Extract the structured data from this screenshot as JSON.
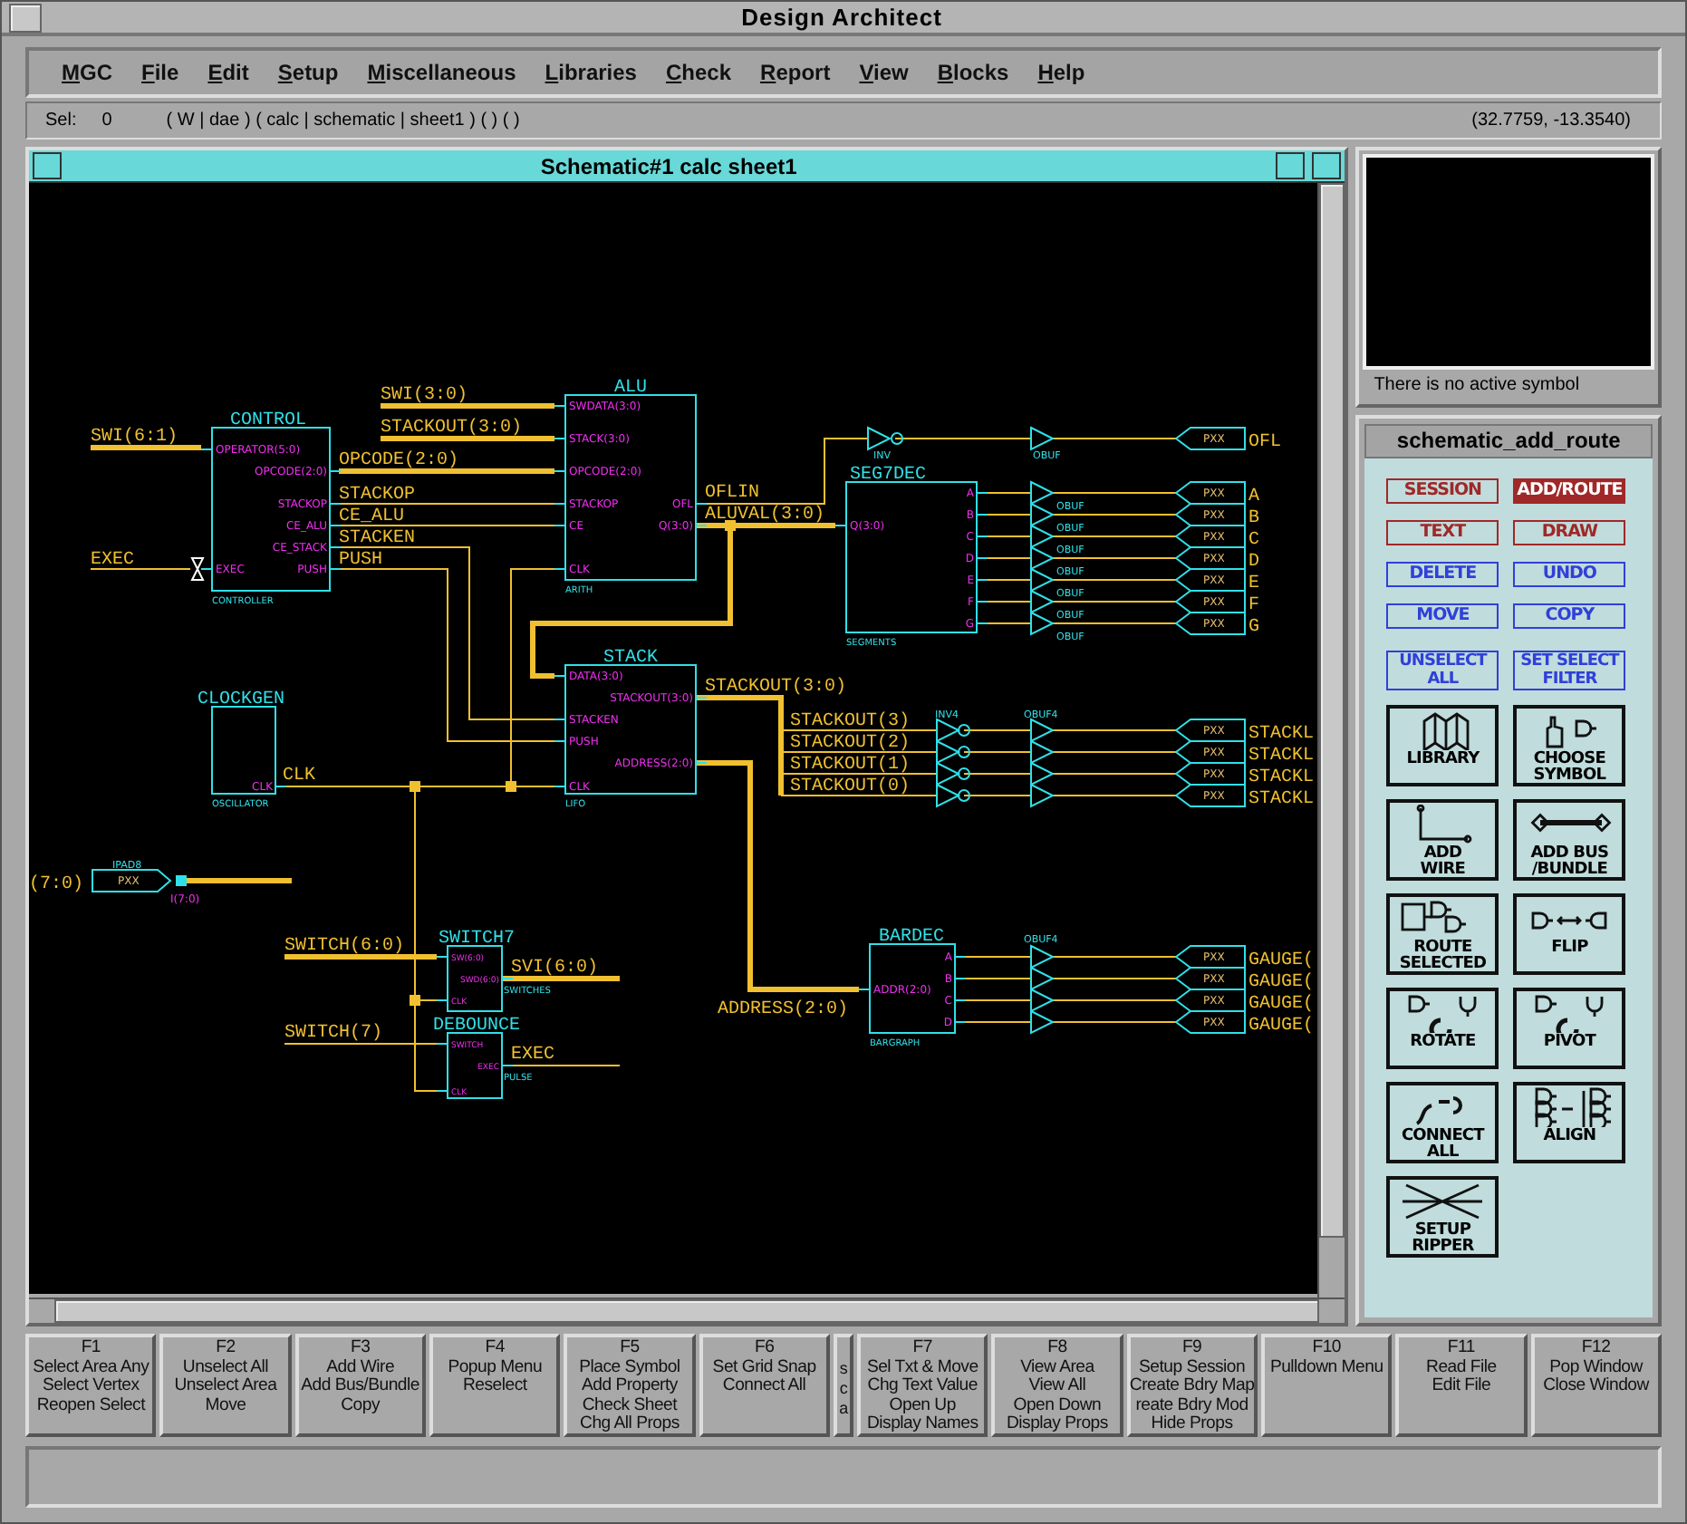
{
  "window": {
    "title": "Design Architect"
  },
  "menu": [
    "MGC",
    "File",
    "Edit",
    "Setup",
    "Miscellaneous",
    "Libraries",
    "Check",
    "Report",
    "View",
    "Blocks",
    "Help"
  ],
  "status": {
    "sel_label": "Sel:",
    "sel_count": "0",
    "context": "( W | dae ) ( calc | schematic | sheet1 ) ( ) ( )",
    "coordinates": "(32.7759, -13.3540)"
  },
  "schematic_window": {
    "title": "Schematic#1 calc sheet1"
  },
  "schematic": {
    "symbols": [
      {
        "name": "CONTROL",
        "footer": "CONTROLLER",
        "pins_left": [
          "OPERATOR(5:0)",
          "EXEC"
        ],
        "pins_right": [
          "OPCODE(2:0)",
          "STACKOP",
          "CE_ALU",
          "CE_STACK",
          "PUSH"
        ]
      },
      {
        "name": "CLOCKGEN",
        "footer": "OSCILLATOR",
        "pins_right": [
          "CLK"
        ]
      },
      {
        "name": "SWITCH7",
        "footer": "SWITCHES",
        "pins_left": [
          "SW(6:0)",
          "CLK"
        ],
        "pins_right": [
          "SWD(6:0)"
        ]
      },
      {
        "name": "DEBOUNCE",
        "footer": "PULSE",
        "pins_left": [
          "SWITCH",
          "CLK"
        ],
        "pins_right": [
          "EXEC"
        ]
      },
      {
        "name": "ALU",
        "footer": "ARITH",
        "pins_left": [
          "SWDATA(3:0)",
          "STACK(3:0)",
          "OPCODE(2:0)",
          "STACKOP",
          "CE",
          "CLK"
        ],
        "pins_right": [
          "OFL",
          "Q(3:0)"
        ]
      },
      {
        "name": "STACK",
        "footer": "LIFO",
        "pins_left": [
          "DATA(3:0)",
          "STACKEN",
          "PUSH",
          "CLK"
        ],
        "pins_right": [
          "STACKOUT(3:0)",
          "ADDRESS(2:0)"
        ]
      },
      {
        "name": "SEG7DEC",
        "footer": "SEGMENTS",
        "pins_left": [
          "Q(3:0)"
        ],
        "pins_right": [
          "A",
          "B",
          "C",
          "D",
          "E",
          "F",
          "G"
        ]
      },
      {
        "name": "BARDEC",
        "footer": "BARGRAPH",
        "pins_left": [
          "ADDR(2:0)"
        ],
        "pins_right": [
          "A",
          "B",
          "C",
          "D"
        ]
      }
    ],
    "net_labels": [
      "SWI(6:1)",
      "EXEC",
      "SWI(3:0)",
      "STACKOUT(3:0)",
      "OPCODE(2:0)",
      "STACKOP",
      "CE_ALU",
      "STACKEN",
      "PUSH",
      "OFLIN",
      "ALUVAL(3:0)",
      "STACKOUT(3:0)",
      "STACKOUT(3)",
      "STACKOUT(2)",
      "STACKOUT(1)",
      "STACKOUT(0)",
      "CLK",
      "SWITCH(6:0)",
      "SVI(6:0)",
      "SWITCH(7)",
      "EXEC",
      "ADDRESS(2:0)",
      "(7:0)"
    ],
    "gate_labels": [
      "INV",
      "OBUF",
      "OBUF",
      "OBUF",
      "OBUF",
      "OBUF",
      "OBUF",
      "OBUF",
      "OBUF",
      "INV4",
      "OBUF4",
      "OBUF4"
    ],
    "output_ports": [
      {
        "port": "PXX",
        "net": "OFL"
      },
      {
        "port": "PXX",
        "net": "A"
      },
      {
        "port": "PXX",
        "net": "B"
      },
      {
        "port": "PXX",
        "net": "C"
      },
      {
        "port": "PXX",
        "net": "D"
      },
      {
        "port": "PXX",
        "net": "E"
      },
      {
        "port": "PXX",
        "net": "F"
      },
      {
        "port": "PXX",
        "net": "G"
      },
      {
        "port": "PXX",
        "net": "STACKL"
      },
      {
        "port": "PXX",
        "net": "STACKL"
      },
      {
        "port": "PXX",
        "net": "STACKL"
      },
      {
        "port": "PXX",
        "net": "STACKL"
      },
      {
        "port": "PXX",
        "net": "GAUGE("
      },
      {
        "port": "PXX",
        "net": "GAUGE("
      },
      {
        "port": "PXX",
        "net": "GAUGE("
      },
      {
        "port": "PXX",
        "net": "GAUGE("
      }
    ],
    "input_port": {
      "label": "IPAD8",
      "port": "PXX",
      "pin": "I(7:0)"
    }
  },
  "symbol_viewer": {
    "message": "There is no active symbol"
  },
  "palette": {
    "title": "schematic_add_route",
    "text_buttons": [
      {
        "lines": [
          "SESSION"
        ],
        "color": "#a02828",
        "selected": false
      },
      {
        "lines": [
          "ADD/ROUTE"
        ],
        "color": "#a02828",
        "selected": true
      },
      {
        "lines": [
          "TEXT"
        ],
        "color": "#a02828",
        "selected": false
      },
      {
        "lines": [
          "DRAW"
        ],
        "color": "#a02828",
        "selected": false
      },
      {
        "lines": [
          "DELETE"
        ],
        "color": "#3040d8",
        "selected": false
      },
      {
        "lines": [
          "UNDO"
        ],
        "color": "#3040d8",
        "selected": false
      },
      {
        "lines": [
          "MOVE"
        ],
        "color": "#3040d8",
        "selected": false
      },
      {
        "lines": [
          "COPY"
        ],
        "color": "#3040d8",
        "selected": false
      },
      {
        "lines": [
          "UNSELECT",
          "ALL"
        ],
        "color": "#3040d8",
        "selected": false
      },
      {
        "lines": [
          "SET SELECT",
          "FILTER"
        ],
        "color": "#3040d8",
        "selected": false
      }
    ],
    "icon_buttons": [
      {
        "kind": "library",
        "lines": [
          "LIBRARY"
        ]
      },
      {
        "kind": "choose",
        "lines": [
          "CHOOSE",
          "SYMBOL"
        ]
      },
      {
        "kind": "wire",
        "lines": [
          "ADD",
          "WIRE"
        ]
      },
      {
        "kind": "bus",
        "lines": [
          "ADD BUS",
          "/BUNDLE"
        ]
      },
      {
        "kind": "route",
        "lines": [
          "ROUTE",
          "SELECTED"
        ]
      },
      {
        "kind": "flip",
        "lines": [
          "FLIP"
        ]
      },
      {
        "kind": "rotate",
        "lines": [
          "ROTATE"
        ]
      },
      {
        "kind": "pivot",
        "lines": [
          "PIVOT"
        ]
      },
      {
        "kind": "connect",
        "lines": [
          "CONNECT",
          "ALL"
        ]
      },
      {
        "kind": "align",
        "lines": [
          "ALIGN"
        ]
      },
      {
        "kind": "ripper",
        "lines": [
          "SETUP",
          "RIPPER"
        ]
      }
    ]
  },
  "function_keys": [
    {
      "kind": "key",
      "key": "F1",
      "lines": [
        "Select Area Any",
        "Select Vertex",
        "Reopen Select"
      ]
    },
    {
      "kind": "key",
      "key": "F2",
      "lines": [
        "Unselect All",
        "Unselect Area",
        "Move"
      ]
    },
    {
      "kind": "key",
      "key": "F3",
      "lines": [
        "Add Wire",
        "Add Bus/Bundle",
        "Copy"
      ]
    },
    {
      "kind": "key",
      "key": "F4",
      "lines": [
        "Popup Menu",
        "Reselect"
      ]
    },
    {
      "kind": "key",
      "key": "F5",
      "lines": [
        "Place Symbol",
        "Add Property",
        "Check Sheet",
        "Chg All Props"
      ]
    },
    {
      "kind": "key",
      "key": "F6",
      "lines": [
        "Set Grid Snap",
        "Connect All"
      ]
    },
    {
      "kind": "stub",
      "lines": [
        "s",
        "c",
        "a"
      ]
    },
    {
      "kind": "key",
      "key": "F7",
      "lines": [
        "Sel Txt & Move",
        "Chg Text Value",
        "Open Up",
        "Display Names"
      ]
    },
    {
      "kind": "key",
      "key": "F8",
      "lines": [
        "View Area",
        "View All",
        "Open Down",
        "Display Props"
      ]
    },
    {
      "kind": "key",
      "key": "F9",
      "lines": [
        "Setup Session",
        "Create Bdry Map",
        "reate Bdry Mod",
        "Hide Props"
      ]
    },
    {
      "kind": "key",
      "key": "F10",
      "lines": [
        "Pulldown Menu"
      ]
    },
    {
      "kind": "key",
      "key": "F11",
      "lines": [
        "Read File",
        "Edit File"
      ]
    },
    {
      "kind": "key",
      "key": "F12",
      "lines": [
        "Pop Window",
        "Close Window"
      ]
    }
  ]
}
